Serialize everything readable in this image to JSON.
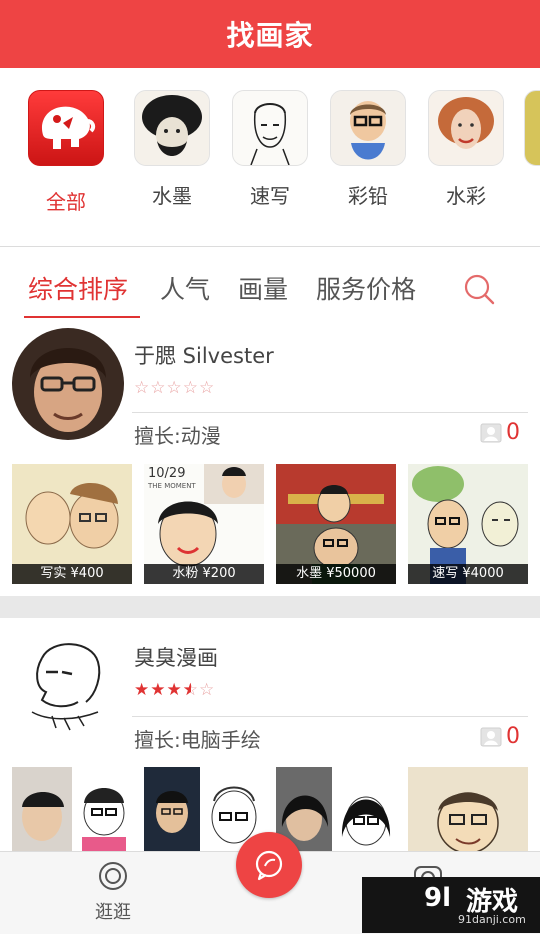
{
  "header": {
    "title": "找画家"
  },
  "categories": [
    {
      "label": "全部",
      "icon": "elephant-logo-icon",
      "active": true
    },
    {
      "label": "水墨",
      "icon": "portrait-ink-thumb"
    },
    {
      "label": "速写",
      "icon": "portrait-sketch-thumb"
    },
    {
      "label": "彩铅",
      "icon": "portrait-pencil-thumb"
    },
    {
      "label": "水彩",
      "icon": "portrait-watercolor-thumb"
    }
  ],
  "tabs": [
    {
      "label": "综合排序",
      "active": true
    },
    {
      "label": "人气"
    },
    {
      "label": "画量"
    },
    {
      "label": "服务价格"
    }
  ],
  "artists": [
    {
      "name": "于腮 Silvester",
      "rating": 0,
      "rating_max": 5,
      "specialty": "擅长:动漫",
      "count": "0",
      "works": [
        {
          "caption": "写实 ¥400"
        },
        {
          "caption": "水粉 ¥200",
          "overlay_text": "10/29",
          "overlay_sub": "THE MOMENT"
        },
        {
          "caption": "水墨 ¥50000"
        },
        {
          "caption": "速写 ¥4000"
        }
      ]
    },
    {
      "name": "臭臭漫画",
      "rating": 3.5,
      "rating_max": 5,
      "specialty": "擅长:电脑手绘",
      "count": "0",
      "works": [
        {},
        {},
        {},
        {}
      ]
    }
  ],
  "bottom_nav": {
    "browse_label": "逛逛"
  },
  "watermark": {
    "text": "游戏",
    "logo": "9l",
    "url": "91danji.com"
  },
  "colors": {
    "accent": "#ee4444",
    "accent_text": "#e03333"
  }
}
